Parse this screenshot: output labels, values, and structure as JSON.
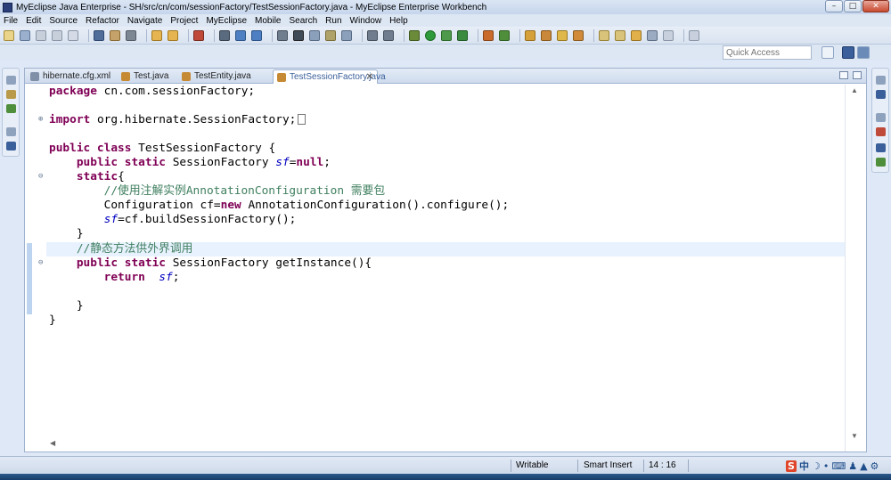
{
  "window": {
    "title": "MyEclipse Java Enterprise - SH/src/cn/com/sessionFactory/TestSessionFactory.java - MyEclipse Enterprise Workbench",
    "minimize": "–",
    "maximize": "□",
    "close": "✕"
  },
  "menu": [
    "File",
    "Edit",
    "Source",
    "Refactor",
    "Navigate",
    "Project",
    "MyEclipse",
    "Mobile",
    "Search",
    "Run",
    "Window",
    "Help"
  ],
  "quick_access": {
    "placeholder": "Quick Access"
  },
  "tabs": [
    {
      "label": "hibernate.cfg.xml"
    },
    {
      "label": "Test.java"
    },
    {
      "label": "TestEntity.java"
    },
    {
      "label": "TestSessionFactory.java",
      "close": "✕"
    }
  ],
  "code": {
    "line1_kw": "package",
    "line1_rest": " cn.com.sessionFactory;",
    "line2_kw": "import",
    "line2_rest": " org.hibernate.SessionFactory;",
    "line3_kw": "public class",
    "line3_rest": " TestSessionFactory {",
    "line4_kw": "public static",
    "line4_type": " SessionFactory ",
    "line4_field": "sf",
    "line4_eq": "=",
    "line4_null": "null",
    "line4_end": ";",
    "line5_kw": "static",
    "line5_end": "{",
    "line6_comment": "//使用注解实例AnnotationConfiguration 需要包",
    "line7_a": "Configuration cf=",
    "line7_kw": "new",
    "line7_b": " AnnotationConfiguration().configure();",
    "line8_field": "sf",
    "line8_rest": "=cf.buildSessionFactory();",
    "line9": "}",
    "line10_comment": "//静态方法供外界调用",
    "line11_kw": "public static",
    "line11_rest": " SessionFactory getInstance(){",
    "line12_kw": "return",
    "line12_sp": "  ",
    "line12_field": "sf",
    "line12_end": ";",
    "line13": "}",
    "line14": "}"
  },
  "status": {
    "mode": "Writable",
    "insert": "Smart Insert",
    "position": "14 : 16"
  },
  "ime": {
    "logo": "S",
    "lang": "中"
  }
}
